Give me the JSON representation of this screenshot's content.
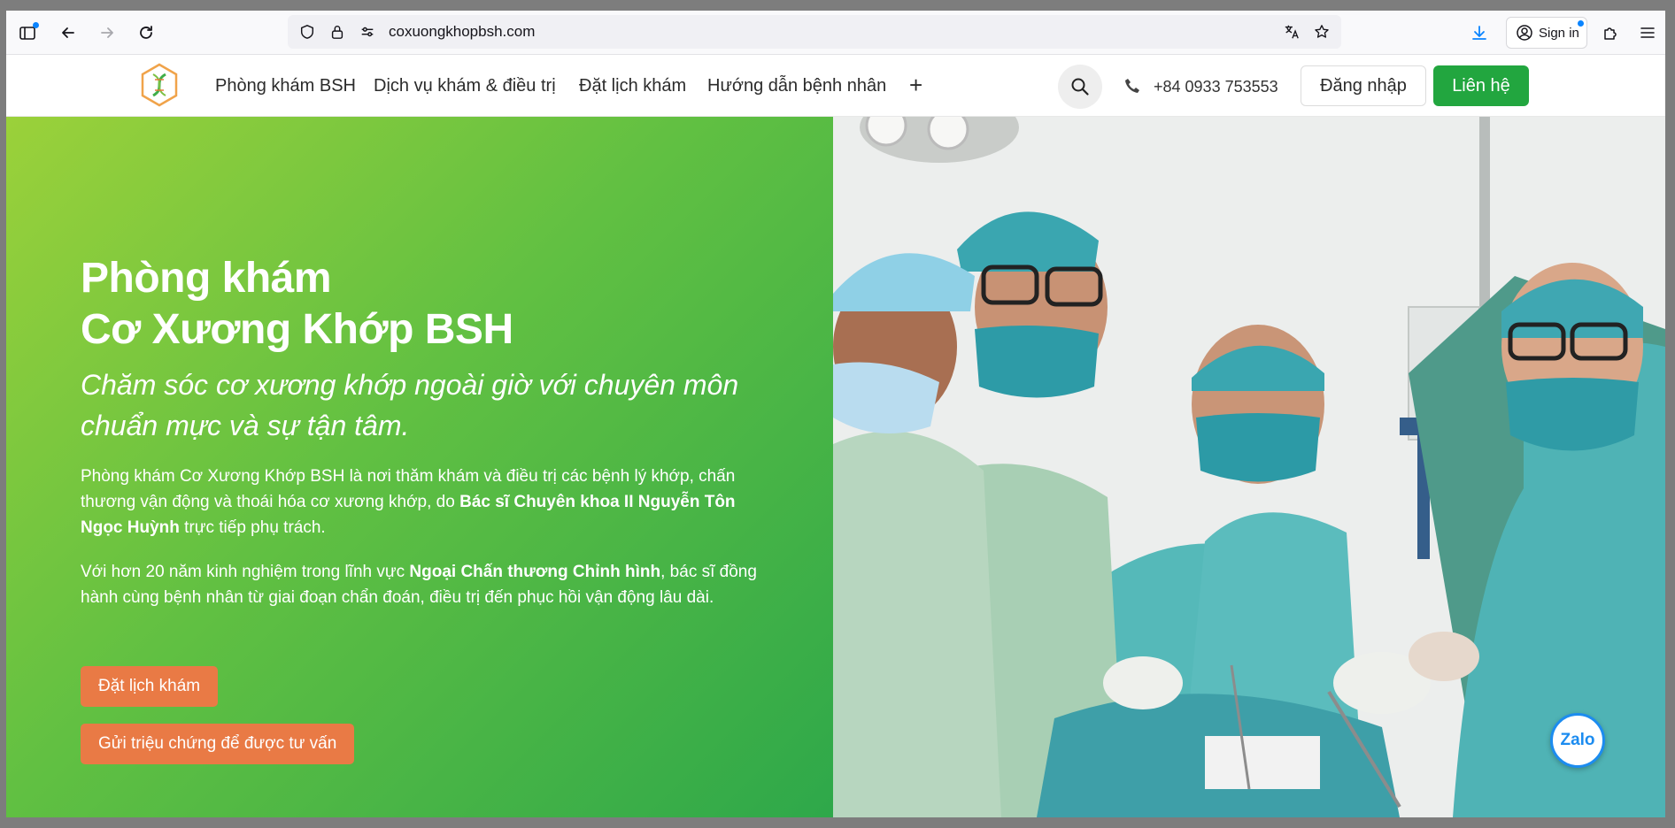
{
  "browser": {
    "url": "coxuongkhopbsh.com",
    "signin_label": "Sign in"
  },
  "nav": {
    "items": [
      "Phòng khám BSH",
      "Dịch vụ khám & điều trị",
      "Đặt lịch khám",
      "Hướng dẫn bệnh nhân"
    ],
    "more_label": "+",
    "phone": "+84 0933 753553",
    "login_label": "Đăng nhập",
    "contact_label": "Liên hệ"
  },
  "hero": {
    "title_line1": "Phòng khám",
    "title_line2": "Cơ Xương Khớp BSH",
    "subtitle": "Chăm sóc cơ xương khớp ngoài giờ với chuyên môn chuẩn mực và sự tận tâm.",
    "p1_a": "Phòng khám Cơ Xương Khớp BSH là nơi thăm khám và điều trị các bệnh lý khớp, chấn thương vận động và thoái hóa cơ xương khớp, do ",
    "p1_b": "Bác sĩ Chuyên khoa II Nguyễn Tôn Ngọc Huỳnh",
    "p1_c": " trực tiếp phụ trách.",
    "p2_a": "Với hơn 20 năm kinh nghiệm trong lĩnh vực ",
    "p2_b": "Ngoại Chấn thương Chỉnh hình",
    "p2_c": ", bác sĩ đồng hành cùng bệnh nhân từ giai đoạn chẩn đoán, điều trị đến phục hồi vận động lâu dài.",
    "btn_book": "Đặt lịch khám",
    "btn_consult": "Gửi triệu chứng để được tư vấn"
  },
  "zalo_label": "Zalo"
}
